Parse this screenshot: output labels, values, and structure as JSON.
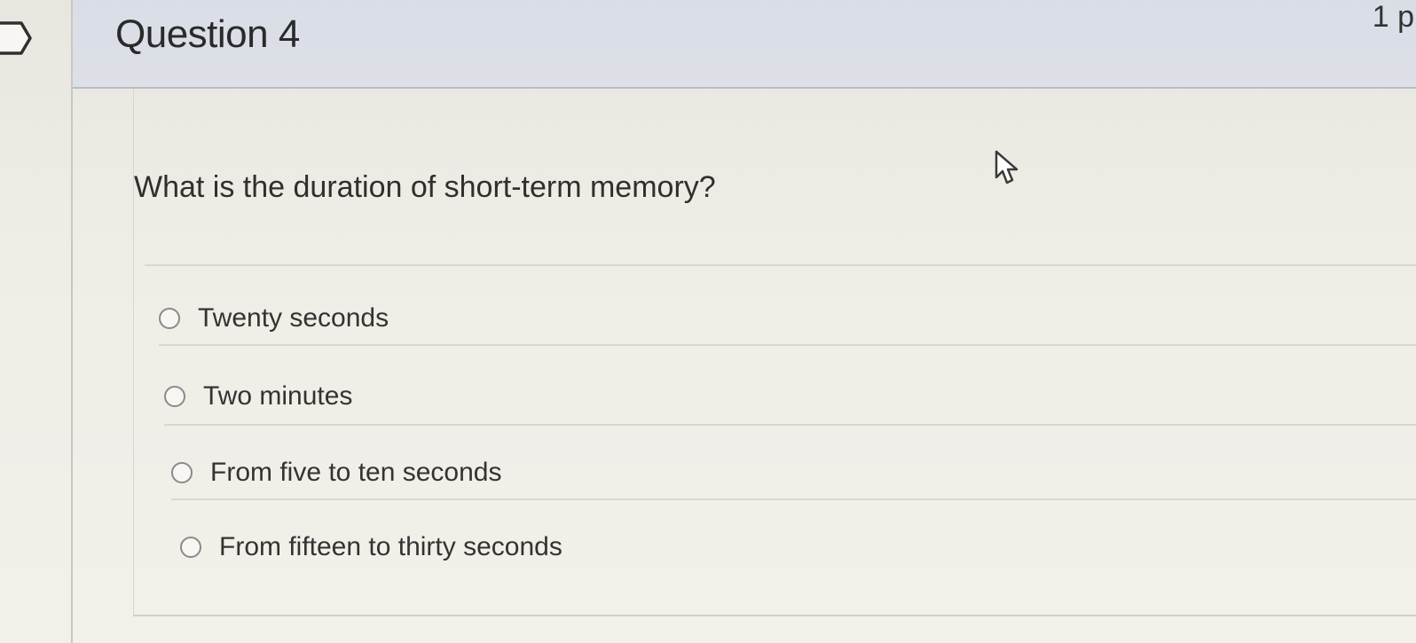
{
  "question": {
    "title": "Question 4",
    "points": "1 p",
    "text": "What is the duration of short-term memory?",
    "answers": [
      {
        "label": "Twenty seconds"
      },
      {
        "label": "Two minutes"
      },
      {
        "label": "From five to ten seconds"
      },
      {
        "label": "From fifteen to thirty seconds"
      }
    ]
  },
  "icons": {
    "flag": "flag-outline-icon",
    "cursor": "mouse-pointer-icon"
  },
  "colors": {
    "header_background": "#d9dde6",
    "page_background": "#efede6",
    "text": "#2f2f2f"
  }
}
